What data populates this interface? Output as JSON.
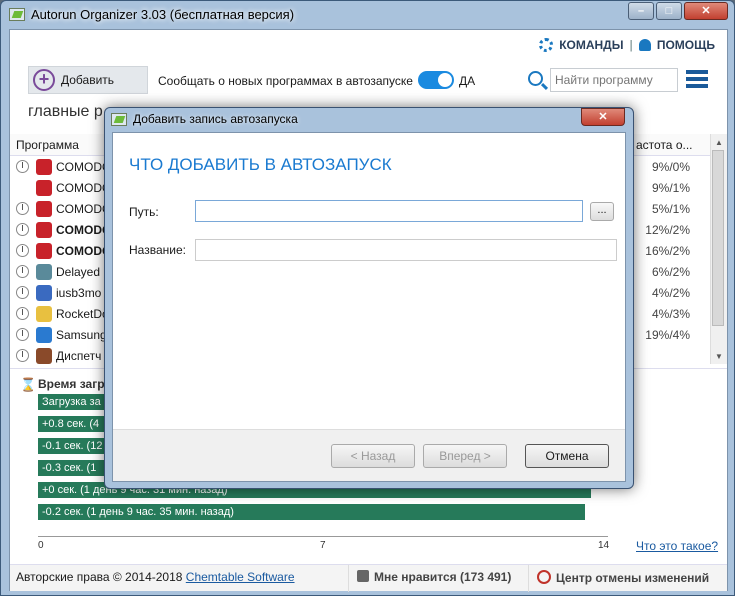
{
  "window": {
    "title": "Autorun Organizer 3.03 (бесплатная версия)",
    "minimize_glyph": "–",
    "maximize_glyph": "□",
    "close_glyph": "✕"
  },
  "toolbar": {
    "commands_label": "КОМАНДЫ",
    "separator": "|",
    "help_label": "ПОМОЩЬ",
    "add_label": "Добавить",
    "add_glyph": "+",
    "notify_label": "Сообщать о новых программах в автозапуске",
    "toggle_value": "ДА",
    "search_placeholder": "Найти программу",
    "section_title": "главные р"
  },
  "list": {
    "header_program": "Программа",
    "header_freq": "астота о...",
    "rows": [
      {
        "name": "COMODO",
        "freq": "9%/0%",
        "icon": "comodo-icon",
        "bold": false,
        "clock": true
      },
      {
        "name": "COMODO",
        "freq": "9%/1%",
        "icon": "comodo-icon",
        "bold": false,
        "clock": false
      },
      {
        "name": "COMODO",
        "freq": "5%/1%",
        "icon": "comodo-icon",
        "bold": false,
        "clock": true
      },
      {
        "name": "COMODO",
        "freq": "12%/2%",
        "icon": "comodo-icon",
        "bold": true,
        "clock": true
      },
      {
        "name": "COMODO",
        "freq": "16%/2%",
        "icon": "comodo-icon",
        "bold": true,
        "clock": true
      },
      {
        "name": "Delayed",
        "freq": "6%/2%",
        "icon": "window-icon",
        "bold": false,
        "clock": true
      },
      {
        "name": "iusb3mo",
        "freq": "4%/2%",
        "icon": "usb-icon",
        "bold": false,
        "clock": true
      },
      {
        "name": "RocketDo",
        "freq": "4%/3%",
        "icon": "rocketdock-icon",
        "bold": false,
        "clock": true
      },
      {
        "name": "Samsung",
        "freq": "19%/4%",
        "icon": "samsung-icon",
        "bold": false,
        "clock": true
      },
      {
        "name": "Диспетч",
        "freq": "",
        "icon": "speaker-icon",
        "bold": false,
        "clock": true
      }
    ]
  },
  "boot": {
    "title": "Время загр",
    "bars": [
      {
        "label": "Загрузка за",
        "frac": 0.14
      },
      {
        "label": "+0.8 сек. (4",
        "frac": 0.14
      },
      {
        "label": "-0.1 сек. (12",
        "frac": 0.14
      },
      {
        "label": "-0.3 сек. (1",
        "frac": 0.14
      },
      {
        "label": "+0 сек. (1 день 9 час. 31 мин. назад)",
        "frac": 0.97
      },
      {
        "label": "-0.2 сек. (1 день 9 час. 35 мин. назад)",
        "frac": 0.96
      }
    ],
    "axis_ticks": [
      "0",
      "7",
      "14"
    ],
    "whats_this": "Что это такое?"
  },
  "footer": {
    "copyright": "Авторские права © 2014-2018",
    "company": "Chemtable Software",
    "like_label": "Мне нравится (173 491)",
    "undo_label": "Центр отмены изменений"
  },
  "dialog": {
    "title": "Добавить запись автозапуска",
    "close_glyph": "✕",
    "heading": "ЧТО ДОБАВИТЬ В АВТОЗАПУСК",
    "path_label": "Путь:",
    "path_value": "",
    "browse_label": "...",
    "name_label": "Название:",
    "name_value": "",
    "back_label": "< Назад",
    "next_label": "Вперед >",
    "cancel_label": "Отмена"
  },
  "colors": {
    "accent": "#1a78c0",
    "bar": "#267a5a",
    "heading": "#1a7ad0"
  }
}
